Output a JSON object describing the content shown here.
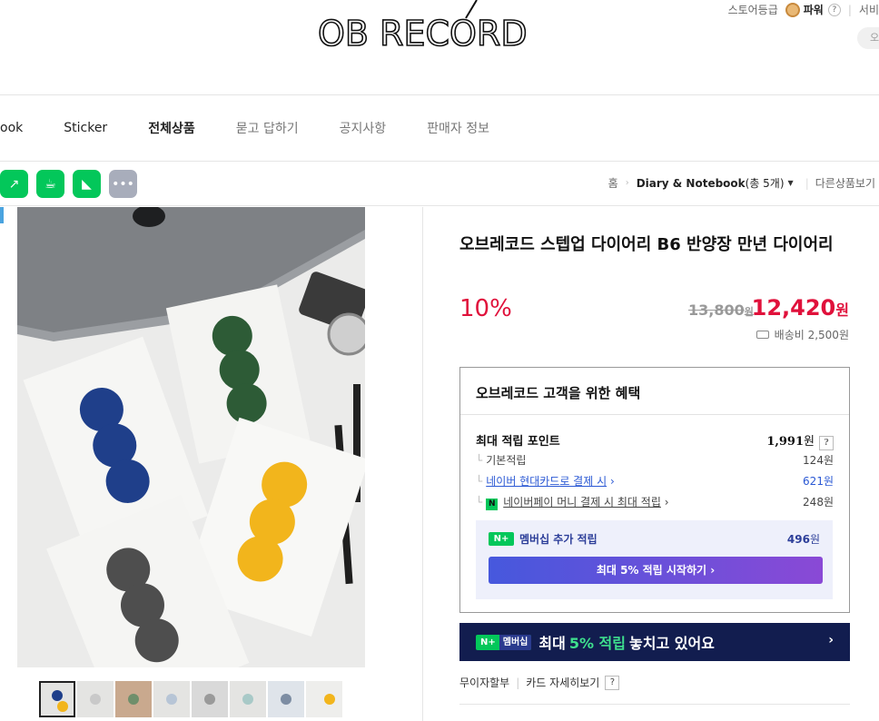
{
  "header": {
    "logo_text": "OB RECORD",
    "store_grade_label": "스토어등급",
    "grade_value": "파워",
    "grade_help": "?",
    "service_label": "서비",
    "search_placeholder": "오"
  },
  "nav": {
    "items": [
      {
        "label": "ook",
        "style": "normal"
      },
      {
        "label": "Sticker",
        "style": "normal"
      },
      {
        "label": "전체상품",
        "style": "bold"
      },
      {
        "label": "묻고 답하기",
        "style": "muted"
      },
      {
        "label": "공지사항",
        "style": "muted"
      },
      {
        "label": "판매자 정보",
        "style": "muted"
      }
    ]
  },
  "share": {
    "icons": [
      {
        "name": "share-green-icon",
        "color": "#03c75a"
      },
      {
        "name": "cup-icon",
        "color": "#03c75a"
      },
      {
        "name": "bookmark-icon",
        "color": "#03c75a"
      },
      {
        "name": "more-icon",
        "color": "#9aa1b3"
      }
    ]
  },
  "breadcrumb": {
    "home": "홈",
    "category": "Diary & Notebook",
    "count": "(총 5개)",
    "other": "다른상품보기"
  },
  "product": {
    "title": "오브레코드 스텝업 다이어리 B6 반양장 만년 다이어리",
    "discount": "10%",
    "original_price": "13,800",
    "original_unit": "원",
    "sale_price": "12,420",
    "sale_unit": "원",
    "shipping": "배송비 2,500원"
  },
  "benefit": {
    "title": "오브레코드 고객을 위한 혜택",
    "max_points_label": "최대 적립 포인트",
    "max_points_value": "1,991",
    "max_points_unit": "원",
    "help": "?",
    "rows": [
      {
        "label": "기본적립",
        "value": "124원",
        "type": "plain"
      },
      {
        "label": "네이버 현대카드로 결제 시",
        "value": "621원",
        "type": "link"
      },
      {
        "label": "네이버페이 머니 결제 시 최대 적립",
        "value": "248원",
        "type": "npay"
      }
    ],
    "membership_badge": "N+",
    "membership_label": "멤버십 추가 적립",
    "membership_value": "496",
    "membership_unit": "원",
    "membership_button": "최대 5% 적립 시작하기 ›"
  },
  "banner": {
    "badge_n": "N+",
    "badge_text": "멤버십",
    "text_before": "최대",
    "highlight": "5% 적립",
    "text_after": "놓치고 있어요",
    "chevron": "›"
  },
  "card": {
    "installment": "무이자할부",
    "details": "카드 자세히보기",
    "help": "?"
  },
  "colors": {
    "accent_red": "#e0113b",
    "naver_green": "#03c75a",
    "link_blue": "#2a58d4",
    "banner_navy": "#121d4f"
  }
}
